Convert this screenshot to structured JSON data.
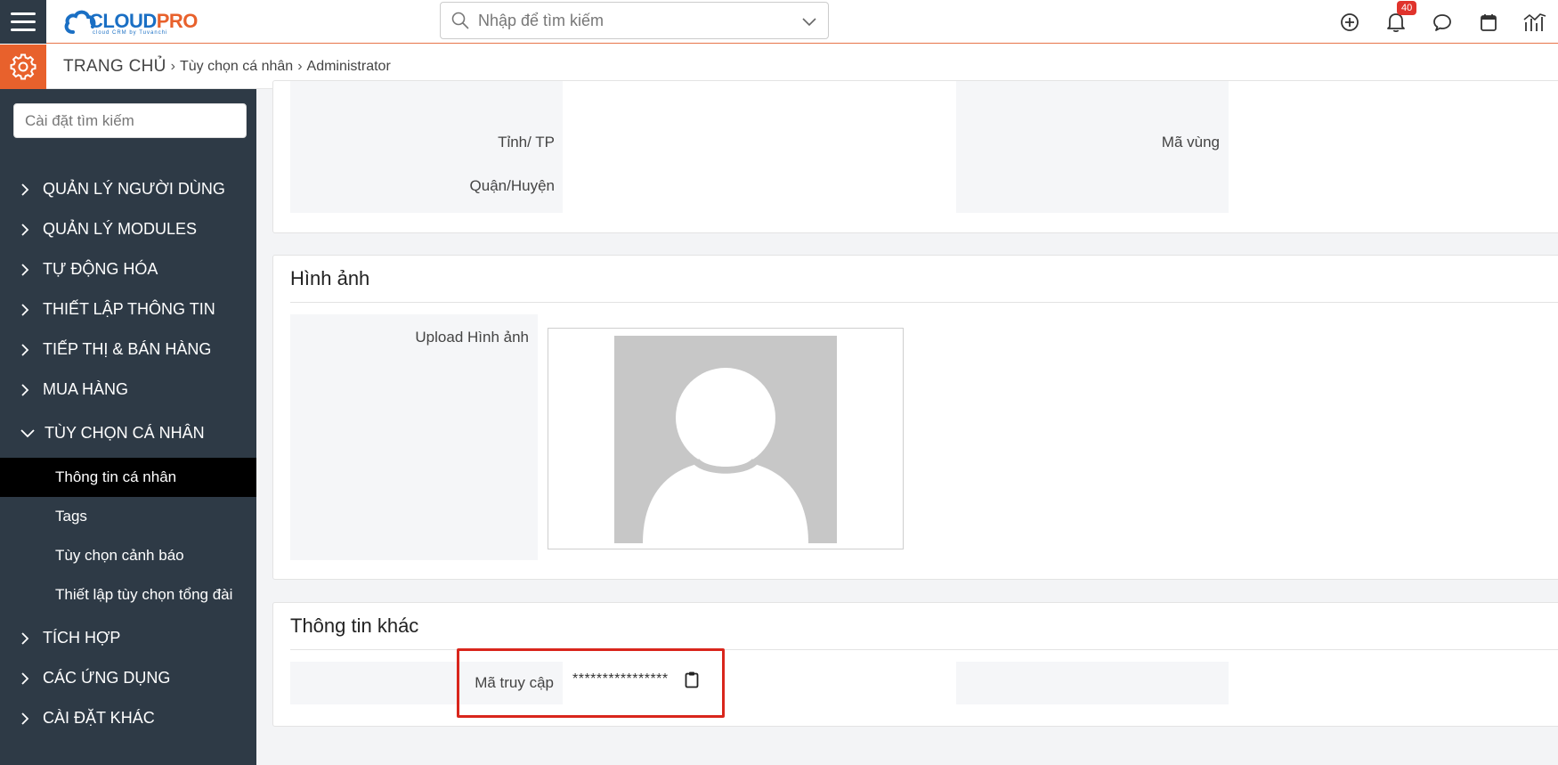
{
  "app": {
    "logo_part1": "CLOUD",
    "logo_part2": "PRO",
    "logo_tagline": "cloud CRM by Tuvanchi",
    "brand_orange": "#e8612c",
    "sidebar_bg": "#2e3a46"
  },
  "header": {
    "search_placeholder": "Nhập để tìm kiếm",
    "notification_count": "40",
    "icons": [
      "add-icon",
      "bell-icon",
      "chat-icon",
      "calendar-icon",
      "report-icon"
    ]
  },
  "breadcrumb": {
    "home": "TRANG CHỦ",
    "level1": "Tùy chọn cá nhân",
    "level2": "Administrator"
  },
  "sidebar": {
    "search_placeholder": "Cài đặt tìm kiếm",
    "items": [
      {
        "label": "QUẢN LÝ NGƯỜI DÙNG"
      },
      {
        "label": "QUẢN LÝ MODULES"
      },
      {
        "label": "TỰ ĐỘNG HÓA"
      },
      {
        "label": "THIẾT LẬP THÔNG TIN"
      },
      {
        "label": "TIẾP THỊ & BÁN HÀNG"
      },
      {
        "label": "MUA HÀNG"
      },
      {
        "label": "TÙY CHỌN CÁ NHÂN"
      },
      {
        "label": "TÍCH HỢP"
      },
      {
        "label": "CÁC ỨNG DỤNG"
      },
      {
        "label": "CÀI ĐẶT KHÁC"
      }
    ],
    "subitems": [
      {
        "label": "Thông tin cá nhân"
      },
      {
        "label": "Tags"
      },
      {
        "label": "Tùy chọn cảnh báo"
      },
      {
        "label": "Thiết lập tùy chọn tổng đài"
      }
    ]
  },
  "address_panel": {
    "province_label": "Tỉnh/ TP",
    "district_label": "Quận/Huyện",
    "area_code_label": "Mã vùng"
  },
  "image_panel": {
    "title": "Hình ảnh",
    "upload_label": "Upload Hình ảnh"
  },
  "other_panel": {
    "title": "Thông tin khác",
    "access_key_label": "Mã truy cập",
    "access_key_value": "****************"
  }
}
